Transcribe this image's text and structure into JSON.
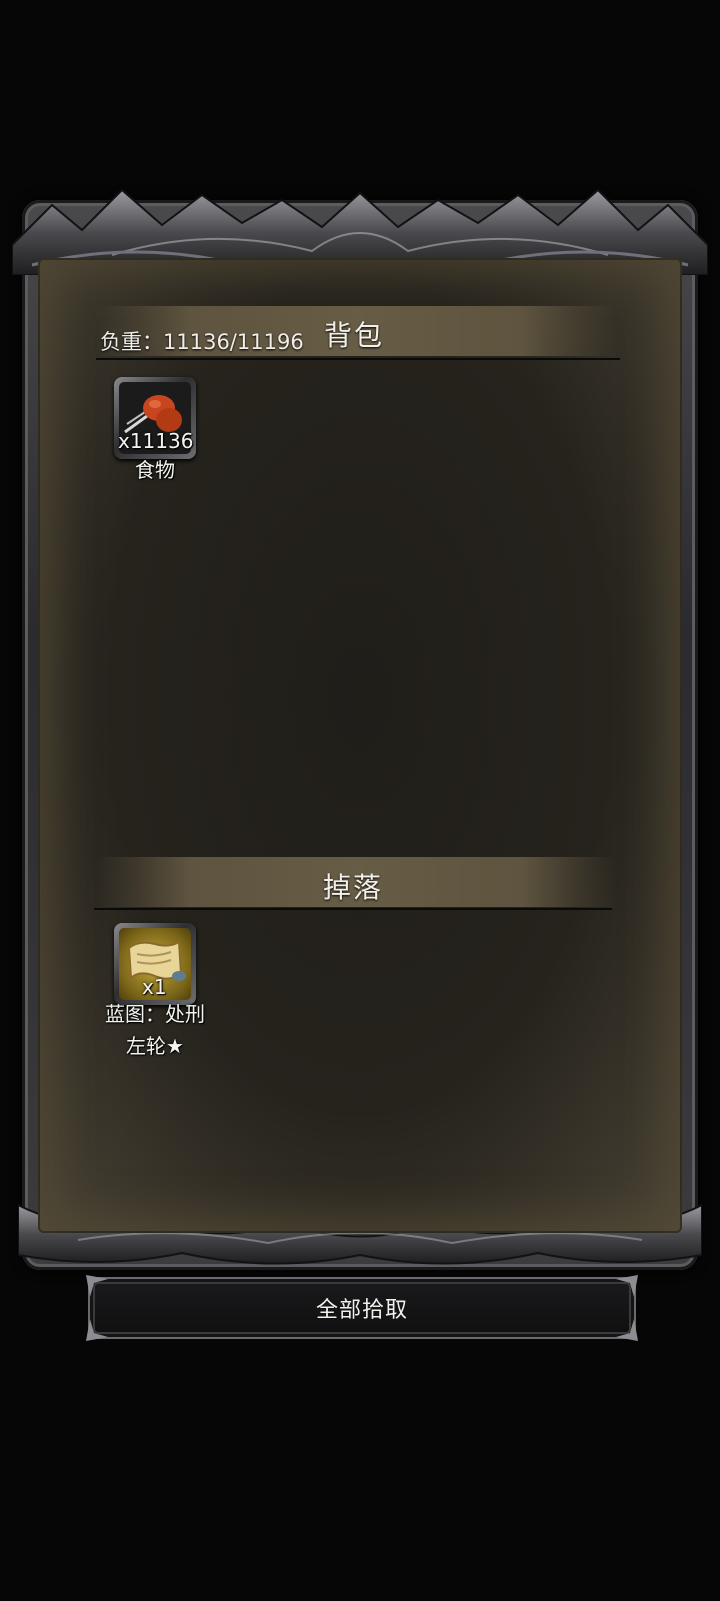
{
  "backpack": {
    "weight_label": "负重：11136/11196",
    "title": "背包",
    "items": [
      {
        "count": "x11136",
        "name": "食物",
        "icon": "meat-icon"
      }
    ]
  },
  "drops": {
    "title": "掉落",
    "items": [
      {
        "count": "x1",
        "name_line1": "蓝图：处刑",
        "name_line2": "左轮★",
        "icon": "blueprint-scroll-icon"
      }
    ]
  },
  "actions": {
    "pickup_all_label": "全部拾取"
  }
}
